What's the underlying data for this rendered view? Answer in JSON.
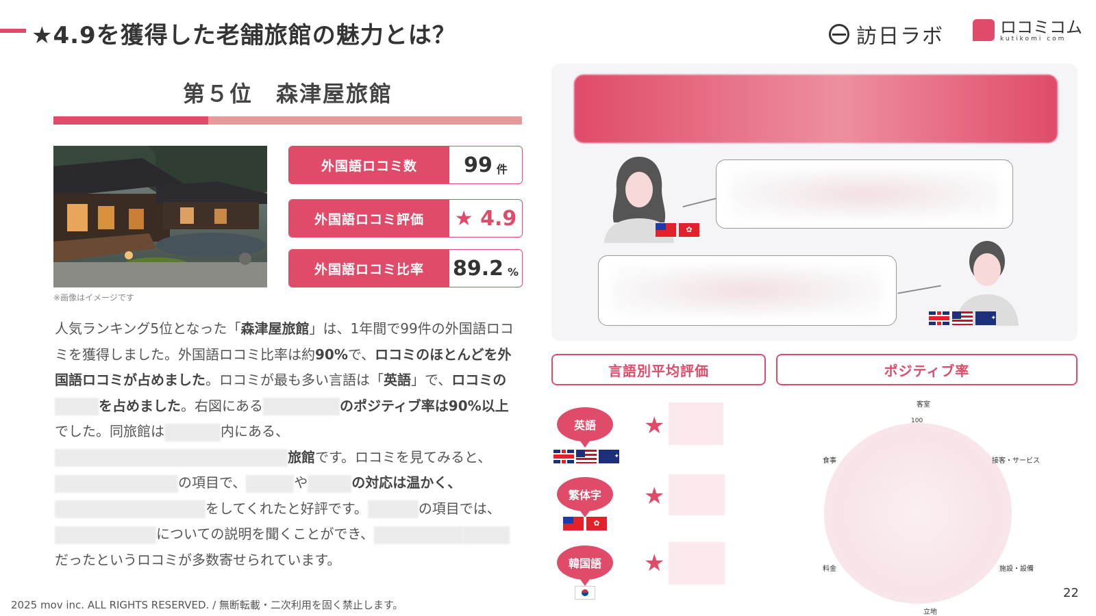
{
  "header": {
    "title": "★4.9を獲得した老舗旅館の魅力とは？",
    "logo_hounichi": "訪日ラボ",
    "logo_kutikomi": "ロコミコム",
    "logo_kutikomi_sub": "kutikomi com"
  },
  "ranking": {
    "title": "第５位　森津屋旅館",
    "progress": 0.33
  },
  "photo_caption": "※画像はイメージです",
  "stats": [
    {
      "label": "外国語ロコミ数",
      "value": "99",
      "unit": "件"
    },
    {
      "label": "外国語ロコミ評価",
      "value": "★ 4.9",
      "unit": ""
    },
    {
      "label": "外国語ロコミ比率",
      "value": "89.2",
      "unit": "%"
    }
  ],
  "body": {
    "s1": "人気ランキング5位となった「",
    "s2": "森津屋旅館",
    "s3": "」は、1年間で99件の外国語ロコミを獲得しました。外国語ロコミ比率は約",
    "s4": "90%",
    "s5": "で、",
    "s6": "ロコミのほとんどを外国語ロコミが占めました",
    "s7": "。ロコミが最も多い言語は「",
    "s8": "英語",
    "s9": "」で、",
    "s10": "ロコミの",
    "s11": "を占めました",
    "s12": "。右図にある",
    "s13": "のポジティブ率は90%以上",
    "s14": "でした。同旅館は",
    "s15": "内にある、",
    "s16": "旅館",
    "s17": "です。ロコミを見てみると、",
    "s18": "の項目で、",
    "s19": "や",
    "s20": "の対応は温かく、",
    "s21": "をしてくれたと好評です。",
    "s22": "の項目では、",
    "s23": "についての説明を聞くことができ、",
    "s24": "だったというロコミが多数寄せられています。"
  },
  "footer": "2025 mov inc. ALL RIGHTS RESERVED. / 無断転載・二次利用を固く禁止します。",
  "page_number": "22",
  "buttons": {
    "lang_avg": "言語別平均評価",
    "positive": "ポジティブ率"
  },
  "languages": [
    {
      "label": "英語",
      "flags": [
        "uk",
        "us",
        "au"
      ]
    },
    {
      "label": "繁体字",
      "flags": [
        "tw",
        "hk"
      ]
    },
    {
      "label": "韓国語",
      "flags": [
        "kr"
      ]
    }
  ],
  "radar": {
    "top": "客室",
    "tick": "100",
    "upper_left": "食事",
    "upper_right": "接客・サービス",
    "lower_left": "料金",
    "lower_right": "施設・設備",
    "bottom": "立地"
  },
  "colors": {
    "accent": "#e04b6a",
    "accent_light": "#e89a9a"
  }
}
